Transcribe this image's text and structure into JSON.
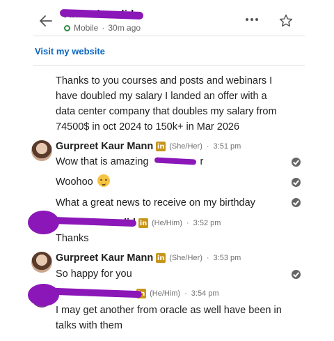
{
  "header": {
    "contact_name": "Ahmed ... ..lid",
    "status": "Mobile",
    "last_seen": "30m ago"
  },
  "visit_website_label": "Visit my website",
  "first_message": {
    "lines": [
      "Thanks to you courses and posts and webinars I",
      "have doubled my salary I landed an offer with a",
      "data center company that doubles my salary from",
      "74500$ in oct 2024 to 150k+ in Mar 2026"
    ]
  },
  "groups": [
    {
      "sender": "Gurpreet Kaur Mann",
      "pronouns": "(She/Her)",
      "time": "3:51 pm",
      "messages": [
        "Wow that is amazing",
        "Woohoo",
        "What a great news to receive on my birthday"
      ],
      "name_suffix": "r"
    },
    {
      "sender": "...lid",
      "pronouns": "(He/Him)",
      "time": "3:52 pm",
      "messages": [
        "Thanks"
      ]
    },
    {
      "sender": "Gurpreet Kaur Mann",
      "pronouns": "(She/Her)",
      "time": "3:53 pm",
      "messages": [
        "So happy for you"
      ]
    },
    {
      "sender": "...",
      "pronouns": "(He/Him)",
      "time": "3:54 pm",
      "messages": [
        "I may get another from oracle as well have been in",
        "talks with them"
      ]
    }
  ],
  "separator": "·",
  "linkedin_badge": "in",
  "colors": {
    "accent": "#0a66c2",
    "redaction": "#8b17b8",
    "online": "#2e8b3d",
    "premium_badge": "#c8951a"
  },
  "icons": {
    "back": "arrow-left-icon",
    "more": "more-horizontal-icon",
    "star": "star-outline-icon",
    "seen": "check-circle-icon",
    "emoji": "partying-face-emoji"
  }
}
